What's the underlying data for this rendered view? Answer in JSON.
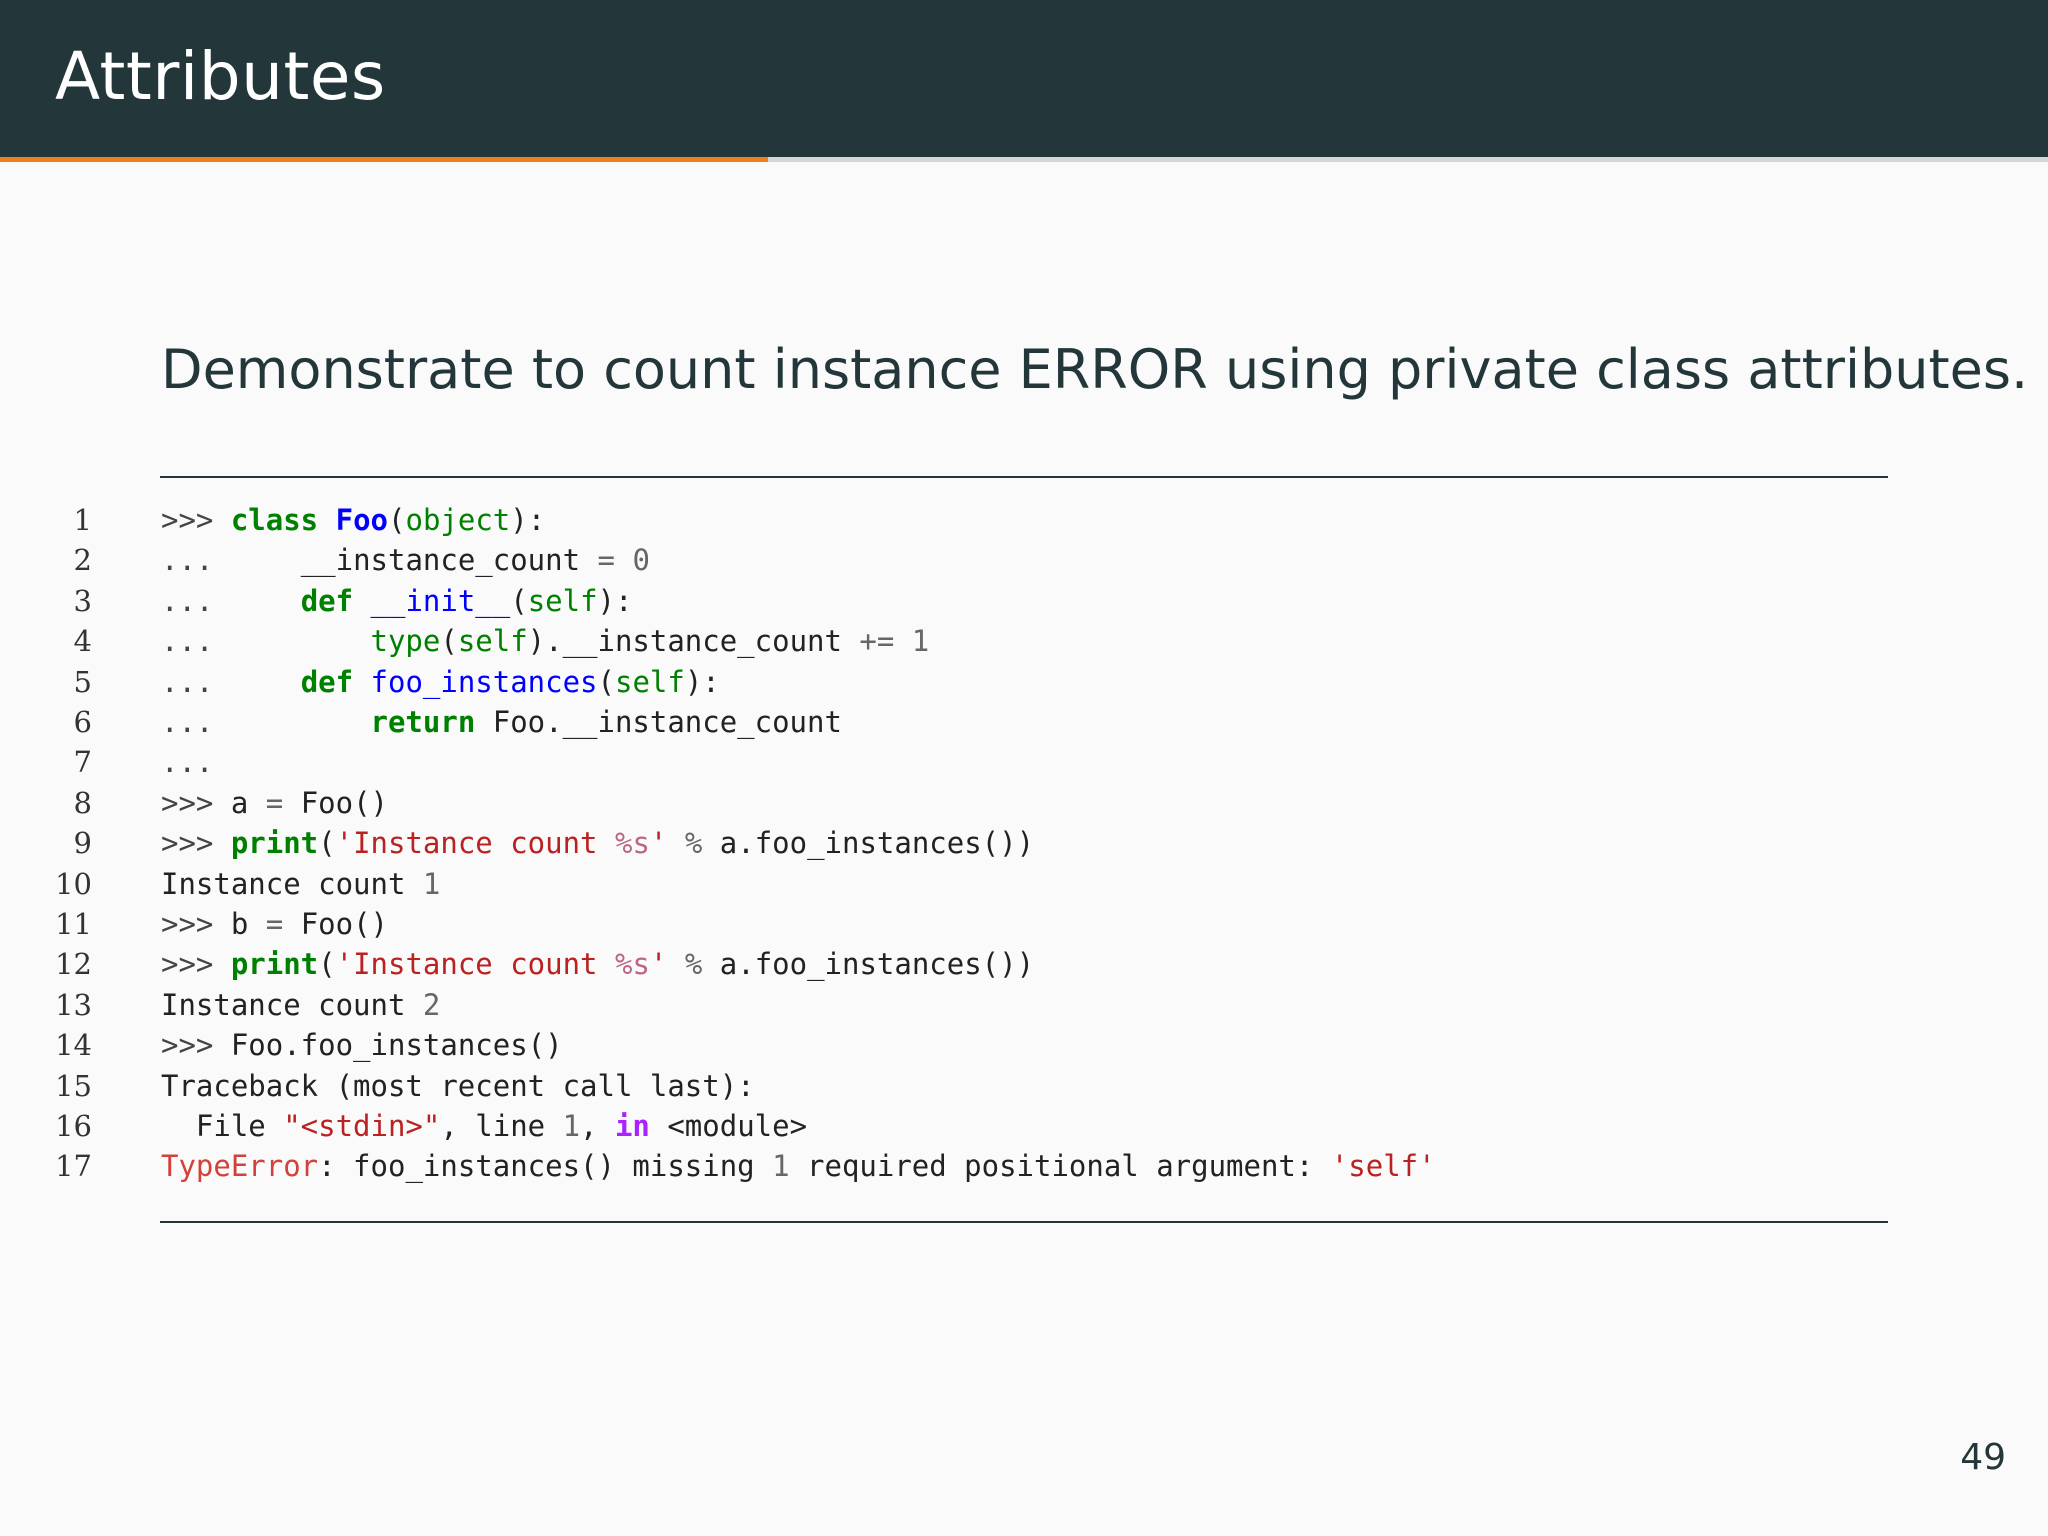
{
  "header": {
    "title": "Attributes",
    "progress": 0.375
  },
  "colors": {
    "header_bg": "#23373b",
    "accent": "#eb811b",
    "background": "#fafafa"
  },
  "slide": {
    "subtitle": "Demonstrate to count instance ERROR using private class attributes.",
    "page_number": "49"
  },
  "code": {
    "lines": [
      {
        "n": "1",
        "tokens": [
          [
            "prompt",
            ">>> "
          ],
          [
            "keyword",
            "class"
          ],
          [
            "plain",
            " "
          ],
          [
            "classname",
            "Foo"
          ],
          [
            "plain",
            "("
          ],
          [
            "builtin",
            "object"
          ],
          [
            "plain",
            "):"
          ]
        ]
      },
      {
        "n": "2",
        "tokens": [
          [
            "prompt",
            "...     "
          ],
          [
            "plain",
            "__instance_count "
          ],
          [
            "op",
            "="
          ],
          [
            "plain",
            " "
          ],
          [
            "number",
            "0"
          ]
        ]
      },
      {
        "n": "3",
        "tokens": [
          [
            "prompt",
            "...     "
          ],
          [
            "keyword",
            "def"
          ],
          [
            "plain",
            " "
          ],
          [
            "funcname",
            "__init__"
          ],
          [
            "plain",
            "("
          ],
          [
            "builtin",
            "self"
          ],
          [
            "plain",
            "):"
          ]
        ]
      },
      {
        "n": "4",
        "tokens": [
          [
            "prompt",
            "...         "
          ],
          [
            "builtin",
            "type"
          ],
          [
            "plain",
            "("
          ],
          [
            "builtin",
            "self"
          ],
          [
            "plain",
            ").__instance_count "
          ],
          [
            "op",
            "+="
          ],
          [
            "plain",
            " "
          ],
          [
            "number",
            "1"
          ]
        ]
      },
      {
        "n": "5",
        "tokens": [
          [
            "prompt",
            "...     "
          ],
          [
            "keyword",
            "def"
          ],
          [
            "plain",
            " "
          ],
          [
            "funcname",
            "foo_instances"
          ],
          [
            "plain",
            "("
          ],
          [
            "builtin",
            "self"
          ],
          [
            "plain",
            "):"
          ]
        ]
      },
      {
        "n": "6",
        "tokens": [
          [
            "prompt",
            "...         "
          ],
          [
            "keyword",
            "return"
          ],
          [
            "plain",
            " Foo.__instance_count"
          ]
        ]
      },
      {
        "n": "7",
        "tokens": [
          [
            "prompt",
            "..."
          ]
        ]
      },
      {
        "n": "8",
        "tokens": [
          [
            "prompt",
            ">>> "
          ],
          [
            "plain",
            "a "
          ],
          [
            "op",
            "="
          ],
          [
            "plain",
            " Foo()"
          ]
        ]
      },
      {
        "n": "9",
        "tokens": [
          [
            "prompt",
            ">>> "
          ],
          [
            "keyword",
            "print"
          ],
          [
            "plain",
            "("
          ],
          [
            "string",
            "'Instance count "
          ],
          [
            "interp",
            "%s"
          ],
          [
            "string",
            "'"
          ],
          [
            "plain",
            " "
          ],
          [
            "op",
            "%"
          ],
          [
            "plain",
            " a.foo_instances())"
          ]
        ]
      },
      {
        "n": "10",
        "tokens": [
          [
            "plain",
            "Instance count "
          ],
          [
            "number",
            "1"
          ]
        ]
      },
      {
        "n": "11",
        "tokens": [
          [
            "prompt",
            ">>> "
          ],
          [
            "plain",
            "b "
          ],
          [
            "op",
            "="
          ],
          [
            "plain",
            " Foo()"
          ]
        ]
      },
      {
        "n": "12",
        "tokens": [
          [
            "prompt",
            ">>> "
          ],
          [
            "keyword",
            "print"
          ],
          [
            "plain",
            "("
          ],
          [
            "string",
            "'Instance count "
          ],
          [
            "interp",
            "%s"
          ],
          [
            "string",
            "'"
          ],
          [
            "plain",
            " "
          ],
          [
            "op",
            "%"
          ],
          [
            "plain",
            " a.foo_instances())"
          ]
        ]
      },
      {
        "n": "13",
        "tokens": [
          [
            "plain",
            "Instance count "
          ],
          [
            "number",
            "2"
          ]
        ]
      },
      {
        "n": "14",
        "tokens": [
          [
            "prompt",
            ">>> "
          ],
          [
            "plain",
            "Foo.foo_instances()"
          ]
        ]
      },
      {
        "n": "15",
        "tokens": [
          [
            "plain",
            "Traceback (most recent call last):"
          ]
        ]
      },
      {
        "n": "16",
        "tokens": [
          [
            "plain",
            "  File "
          ],
          [
            "string",
            "\"<stdin>\""
          ],
          [
            "plain",
            ", line "
          ],
          [
            "number",
            "1"
          ],
          [
            "plain",
            ", "
          ],
          [
            "in",
            "in"
          ],
          [
            "plain",
            " <module>"
          ]
        ]
      },
      {
        "n": "17",
        "tokens": [
          [
            "error",
            "TypeError"
          ],
          [
            "plain",
            ": foo_instances() missing "
          ],
          [
            "number",
            "1"
          ],
          [
            "plain",
            " required positional argument: "
          ],
          [
            "string",
            "'self'"
          ]
        ]
      }
    ]
  }
}
